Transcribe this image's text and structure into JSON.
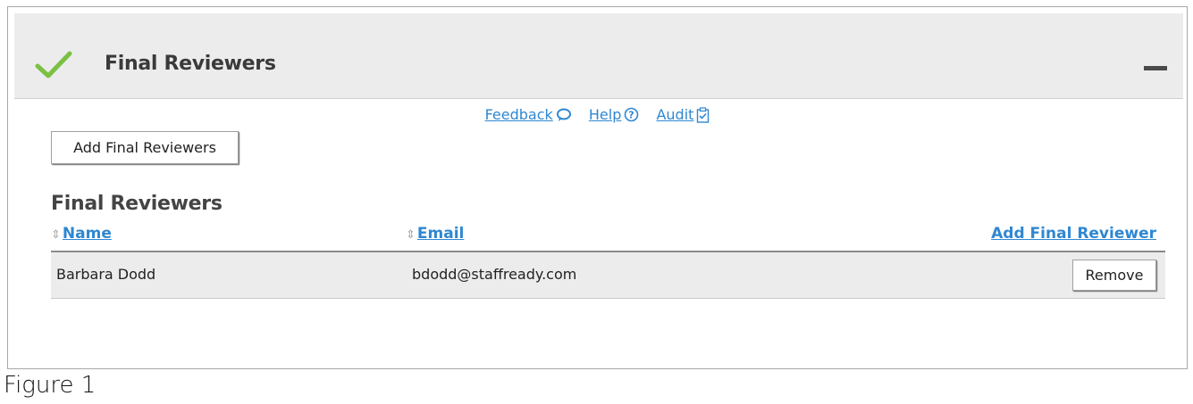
{
  "panel": {
    "title": "Final Reviewers",
    "status_icon": "check-icon",
    "status_color": "#7ac142",
    "collapse_icon": "minus-icon"
  },
  "links": {
    "feedback": "Feedback",
    "help": "Help",
    "audit": "Audit",
    "link_color": "#2f87d1"
  },
  "toolbar": {
    "add_button_label": "Add Final Reviewers"
  },
  "section": {
    "title": "Final Reviewers"
  },
  "table": {
    "columns": {
      "name": "Name",
      "email": "Email",
      "action": "Add Final Reviewer"
    },
    "rows": [
      {
        "name": "Barbara Dodd",
        "email": "bdodd@staffready.com",
        "action_label": "Remove"
      }
    ]
  },
  "caption": "Figure 1"
}
